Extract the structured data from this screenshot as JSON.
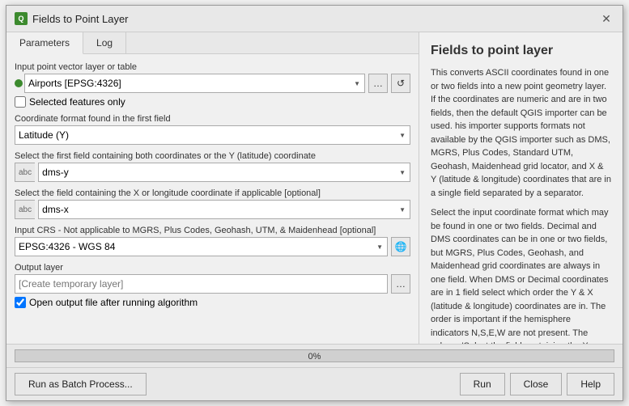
{
  "dialog": {
    "title": "Fields to Point Layer",
    "icon_label": "Q",
    "close_label": "✕"
  },
  "tabs": [
    {
      "id": "parameters",
      "label": "Parameters",
      "active": true
    },
    {
      "id": "log",
      "label": "Log",
      "active": false
    }
  ],
  "params": {
    "input_layer_label": "Input point vector layer or table",
    "input_layer_value": "Airports [EPSG:4326]",
    "selected_features_label": "Selected features only",
    "coord_format_label": "Coordinate format found in the first field",
    "coord_format_value": "Latitude (Y)",
    "first_field_label": "Select the first field containing both coordinates or the Y (latitude) coordinate",
    "first_field_prefix": "abc",
    "first_field_value": "dms-y",
    "x_field_label": "Select the field containing the X or longitude coordinate if applicable [optional]",
    "x_field_prefix": "abc",
    "x_field_value": "dms-x",
    "crs_label": "Input CRS - Not applicable to MGRS, Plus Codes, Geohash, UTM, & Maidenhead [optional]",
    "crs_value": "EPSG:4326 - WGS 84",
    "output_layer_label": "Output layer",
    "output_layer_placeholder": "[Create temporary layer]",
    "open_output_label": "Open output file after running algorithm",
    "open_output_checked": true
  },
  "buttons": {
    "browse_label": "…",
    "refresh_label": "↺",
    "globe_label": "🌐",
    "batch_label": "Run as Batch Process...",
    "run_label": "Run",
    "close_label": "Close",
    "help_label": "Help"
  },
  "progress": {
    "value": 0,
    "label": "0%"
  },
  "help": {
    "title": "Fields to point layer",
    "paragraphs": [
      "This converts ASCII coordinates found in one or two fields into a new point geometry layer. If the coordinates are numeric and are in two fields, then the default QGIS importer can be used. his importer supports formats not available by the QGIS importer such as DMS, MGRS, Plus Codes, Standard UTM, Geohash, Maidenhead grid locator, and X & Y (latitude & longitude) coordinates that are in a single field separated by a separator.",
      "Select the input coordinate format which may be found in one or two fields. Decimal and DMS coordinates can be in one or two fields, but MGRS, Plus Codes, Geohash, and Maidenhead grid coordinates are always in one field. When DMS or Decimal coordinates are in 1 field select which order the Y & X (latitude & longitude) coordinates are in. The order is important if the hemisphere indicators N,S,E,W are not present. The column 'Select the field containing the X or longitude coordinate' is used when the coordinates are in two fields."
    ]
  }
}
